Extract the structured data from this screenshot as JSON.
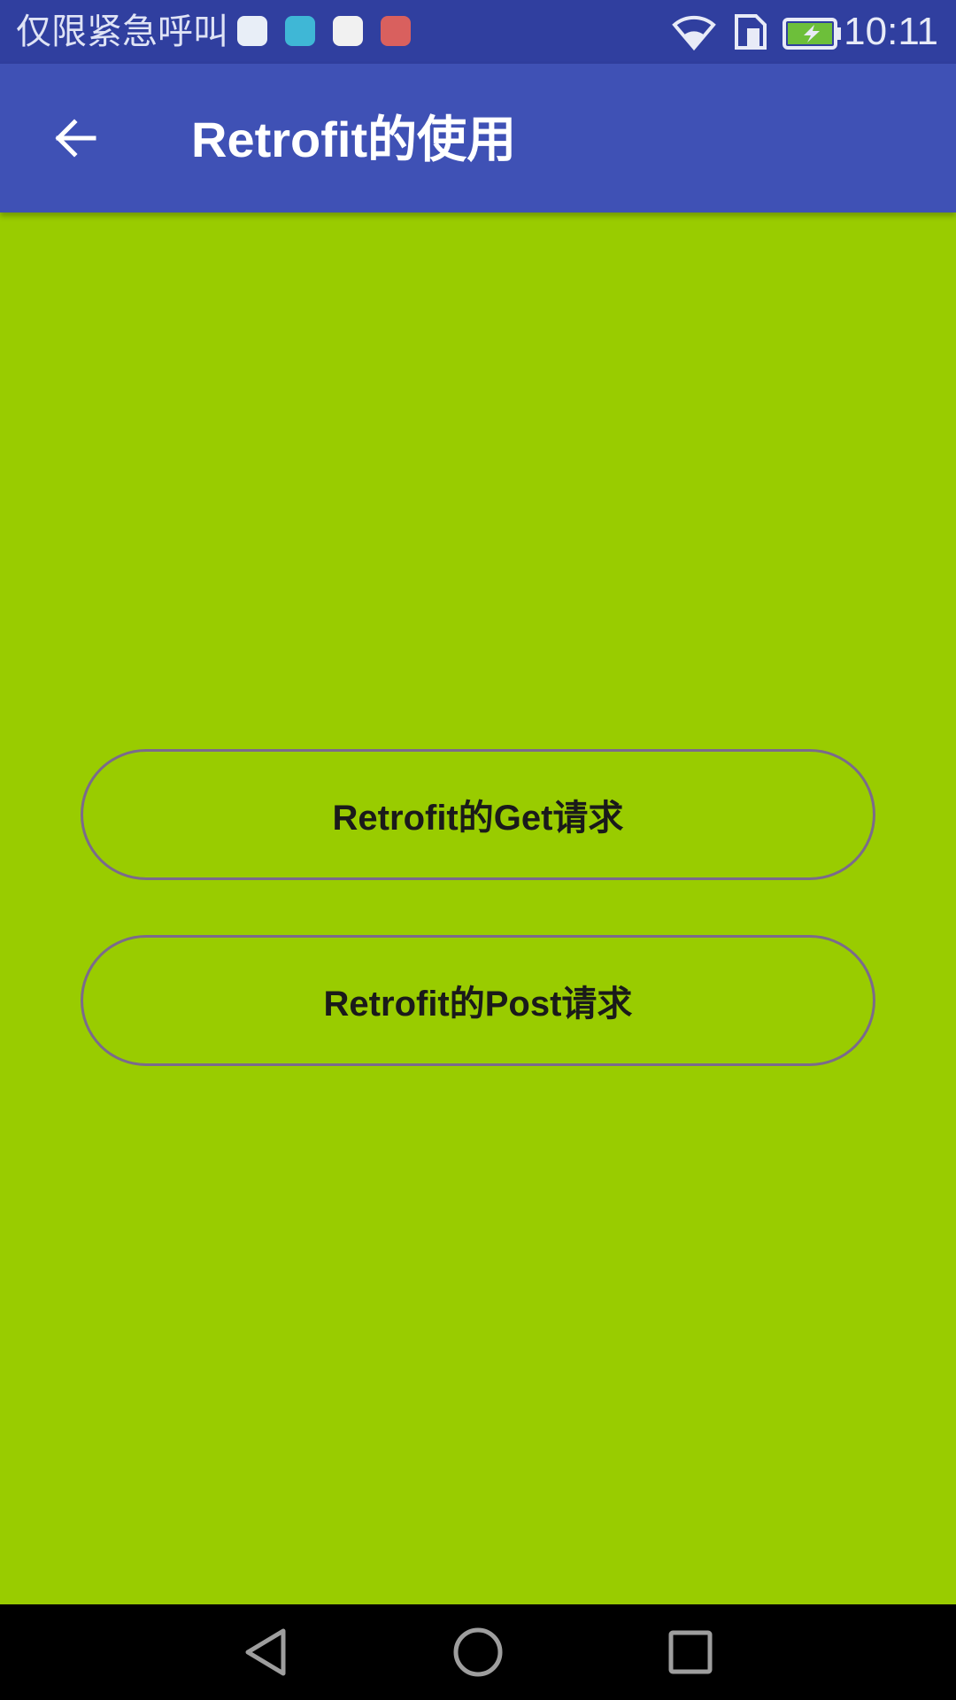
{
  "status_bar": {
    "carrier_text": "仅限紧急呼叫",
    "time": "10:11",
    "notification_icons": [
      "color-ball-app-icon",
      "android-app-icon",
      "news-app-icon",
      "screen-record-icon"
    ],
    "status_icons": [
      "wifi-icon",
      "sim-icon",
      "battery-charging-icon"
    ],
    "color": "#303f9f"
  },
  "app_bar": {
    "back_icon": "arrow-back-icon",
    "title": "Retrofit的使用",
    "color": "#3f51b5"
  },
  "main": {
    "background_color": "#99cc00",
    "buttons": [
      {
        "label": "Retrofit的Get请求"
      },
      {
        "label": "Retrofit的Post请求"
      }
    ]
  },
  "nav_bar": {
    "items": [
      "back-triangle-icon",
      "home-circle-icon",
      "recents-square-icon"
    ]
  }
}
